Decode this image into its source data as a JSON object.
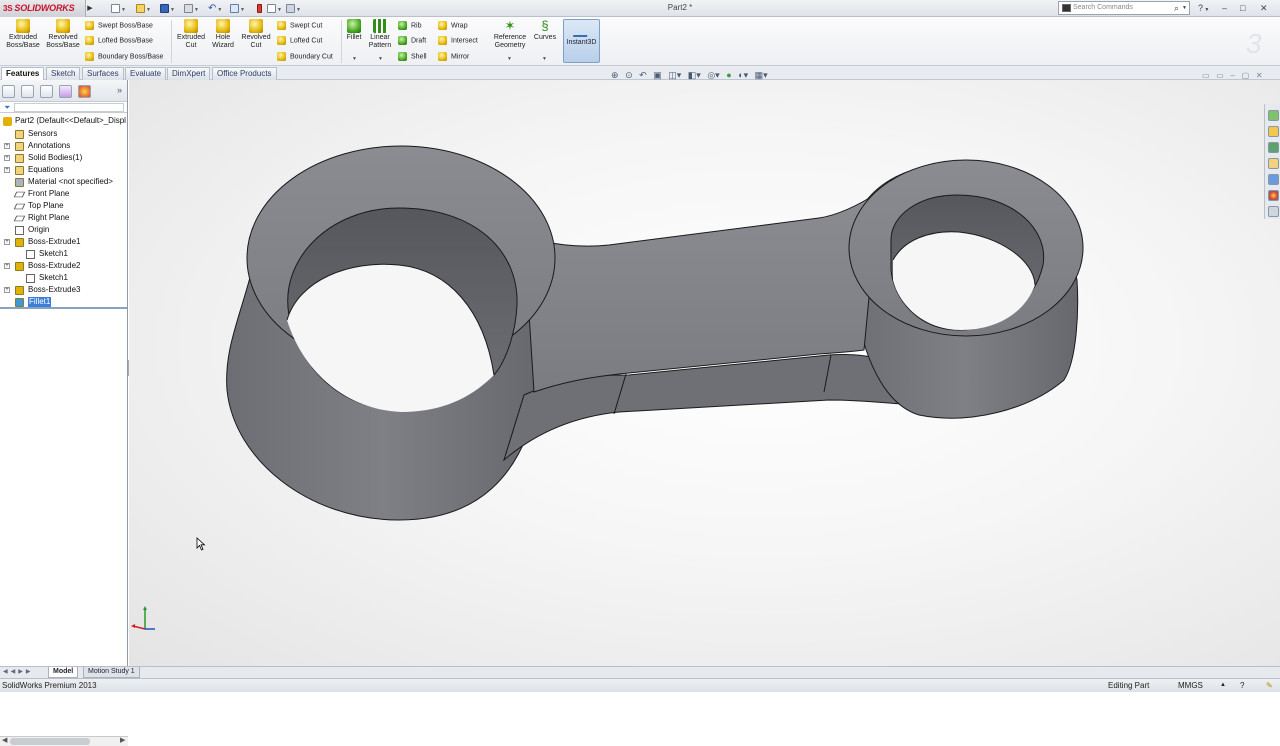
{
  "app": {
    "logo_text": "SOLIDWORKS",
    "logo_mark": "3S",
    "doc_title": "Part2 *",
    "search_placeholder": "Search Commands",
    "help_glyph": "?",
    "window_buttons": [
      "–",
      "□",
      "✕"
    ]
  },
  "ribbon": {
    "extruded_boss": [
      "Extruded",
      "Boss/Base"
    ],
    "revolved_boss": [
      "Revolved",
      "Boss/Base"
    ],
    "swept_boss": "Swept Boss/Base",
    "lofted_boss": "Lofted Boss/Base",
    "boundary_boss": "Boundary Boss/Base",
    "extruded_cut": [
      "Extruded",
      "Cut"
    ],
    "hole_wizard": [
      "Hole",
      "Wizard"
    ],
    "revolved_cut": [
      "Revolved",
      "Cut"
    ],
    "swept_cut": "Swept Cut",
    "lofted_cut": "Lofted Cut",
    "boundary_cut": "Boundary Cut",
    "fillet": "Fillet",
    "linear_pattern": [
      "Linear",
      "Pattern"
    ],
    "rib": "Rib",
    "draft": "Draft",
    "shell": "Shell",
    "wrap": "Wrap",
    "intersect": "Intersect",
    "mirror": "Mirror",
    "reference_geometry": [
      "Reference",
      "Geometry"
    ],
    "curves": "Curves",
    "instant3d": "Instant3D"
  },
  "tabs": [
    "Features",
    "Sketch",
    "Surfaces",
    "Evaluate",
    "DimXpert",
    "Office Products"
  ],
  "tree": {
    "root": "Part2  (Default<<Default>_Displ",
    "items": [
      {
        "label": "Sensors",
        "icon": "sensor-icon"
      },
      {
        "label": "Annotations",
        "icon": "annotations-icon"
      },
      {
        "label": "Solid Bodies(1)",
        "icon": "solid-bodies-icon"
      },
      {
        "label": "Equations",
        "icon": "equations-icon"
      },
      {
        "label": "Material <not specified>",
        "icon": "material-icon"
      },
      {
        "label": "Front Plane",
        "icon": "plane-icon"
      },
      {
        "label": "Top Plane",
        "icon": "plane-icon"
      },
      {
        "label": "Right Plane",
        "icon": "plane-icon"
      },
      {
        "label": "Origin",
        "icon": "origin-icon"
      },
      {
        "label": "Boss-Extrude1",
        "icon": "extrude-icon"
      },
      {
        "label": "Sketch1",
        "icon": "sketch-icon"
      },
      {
        "label": "Boss-Extrude2",
        "icon": "extrude-icon"
      },
      {
        "label": "Sketch1",
        "icon": "sketch-icon"
      },
      {
        "label": "Boss-Extrude3",
        "icon": "extrude-icon"
      },
      {
        "label": "Fillet1",
        "icon": "fillet-icon"
      }
    ]
  },
  "bottom_tabs": [
    "Model",
    "Motion Study 1"
  ],
  "status": {
    "product": "SolidWorks Premium 2013",
    "mode": "Editing Part",
    "units": "MMGS"
  },
  "colors": {
    "part_gray": "#7a7c82",
    "selection_blue": "#3d7fd8",
    "brand_red": "#c8102e"
  }
}
